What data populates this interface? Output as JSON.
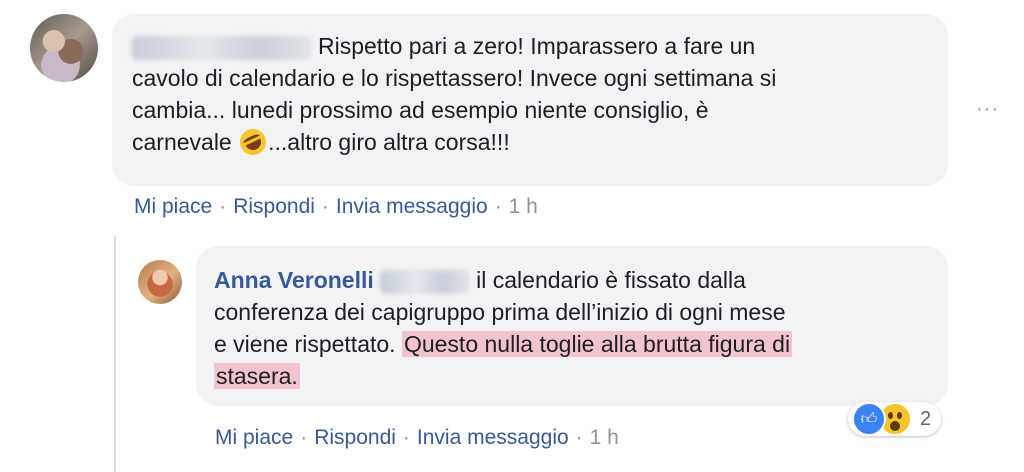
{
  "comments": [
    {
      "author_blurred": true,
      "lines": [
        "Rispetto pari a zero! Imparassero a fare un",
        "cavolo di calendario e lo rispettassero! Invece ogni settimana si",
        "cambia... lunedi prossimo ad esempio niente consiglio, è",
        "carnevale",
        "...altro giro altra corsa!!!"
      ],
      "emoji": "rolling-on-floor-laughing",
      "actions": {
        "like": "Mi piace",
        "reply": "Rispondi",
        "message": "Invia messaggio",
        "time": "1 h"
      },
      "more": "···"
    },
    {
      "author": "Anna Veronelli",
      "line1_rest": "il calendario è fissato dalla",
      "line2": "conferenza dei capigruppo prima dell’inizio di ogni mese",
      "line3_plain": "e viene rispettato.",
      "line3_highlight": "Questo nulla toglie alla brutta figura di",
      "line4_highlight": "stasera.",
      "reactions": {
        "icons": [
          "like-icon",
          "wow-icon"
        ],
        "count": "2"
      },
      "actions": {
        "like": "Mi piace",
        "reply": "Rispondi",
        "message": "Invia messaggio",
        "time": "1 h"
      }
    }
  ],
  "separator": "·"
}
